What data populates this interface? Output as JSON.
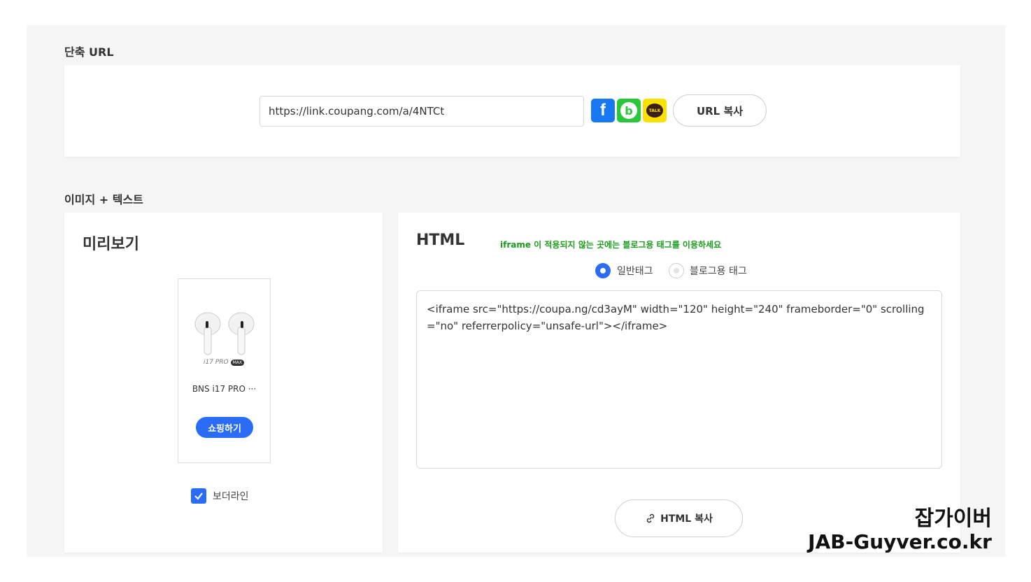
{
  "short_url": {
    "section_label": "단축 URL",
    "url_value": "https://link.coupang.com/a/4NTCt",
    "facebook_glyph": "f",
    "band_glyph": "b",
    "kakao_glyph": "TALK",
    "copy_button": "URL 복사"
  },
  "image_text": {
    "section_label": "이미지 + 텍스트",
    "preview": {
      "title": "미리보기",
      "product_model": "i17 PRO",
      "product_badge": "MAX",
      "product_name": "BNS i17 PRO ···",
      "shop_button": "쇼핑하기",
      "border_checkbox_label": "보더라인",
      "border_checked": true
    },
    "html": {
      "title": "HTML",
      "notice": "iframe 이 적용되지 않는 곳에는 블로그용 태그를 이용하세요",
      "radio_normal_label": "일반태그",
      "radio_blog_label": "블로그용 태그",
      "selected_radio": "일반태그",
      "code": "<iframe src=\"https://coupa.ng/cd3ayM\" width=\"120\" height=\"240\" frameborder=\"0\" scrolling=\"no\" referrerpolicy=\"unsafe-url\"></iframe>",
      "copy_button": "HTML 복사"
    }
  },
  "watermark": {
    "line1": "잡가이버",
    "line2": "JAB-Guyver.co.kr"
  },
  "colors": {
    "accent_blue": "#2a6cf6",
    "notice_green": "#1a9c1a",
    "facebook": "#1877f2",
    "band": "#2ac73b",
    "kakao": "#fae100"
  }
}
